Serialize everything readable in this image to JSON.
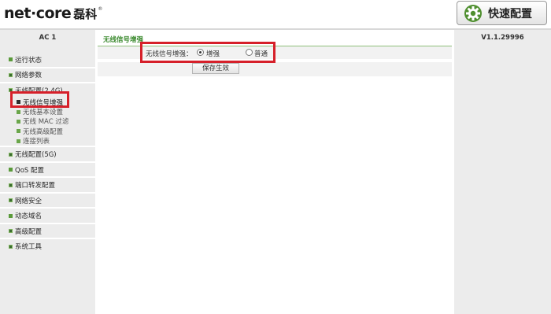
{
  "header": {
    "logo_text": "net·core",
    "logo_cn": "磊科",
    "logo_mark": "®",
    "quick_setup_label": "快速配置",
    "quick_setup_icon": "gear-icon"
  },
  "left": {
    "title": "AC 1"
  },
  "right": {
    "version": "V1.1.29996"
  },
  "menu": {
    "items": [
      {
        "label": "运行状态",
        "bullet": "square"
      },
      {
        "label": "网络参数",
        "bullet": "grid"
      },
      {
        "label": "无线配置(2.4G)",
        "bullet": "lines"
      },
      {
        "label": "无线配置(5G)",
        "bullet": "grid"
      },
      {
        "label": "QoS 配置",
        "bullet": "square"
      },
      {
        "label": "端口转发配置",
        "bullet": "grid"
      },
      {
        "label": "网络安全",
        "bullet": "grid"
      },
      {
        "label": "动态域名",
        "bullet": "square"
      },
      {
        "label": "高级配置",
        "bullet": "grid"
      },
      {
        "label": "系统工具",
        "bullet": "grid"
      }
    ],
    "sub_items": [
      {
        "label": "无线信号增强",
        "active": true
      },
      {
        "label": "无线基本设置",
        "active": false
      },
      {
        "label": "无线 MAC 过滤",
        "active": false
      },
      {
        "label": "无线高级配置",
        "active": false
      },
      {
        "label": "连接列表",
        "active": false
      }
    ]
  },
  "content": {
    "section_title": "无线信号增强",
    "field_label": "无线信号增强：",
    "options": [
      {
        "label": "增强",
        "selected": true
      },
      {
        "label": "普通",
        "selected": false
      }
    ],
    "save_label": "保存生效"
  },
  "colors": {
    "highlight": "#d6202a",
    "section_green": "#3b8a2e",
    "sidebar_bg": "#ececec"
  }
}
